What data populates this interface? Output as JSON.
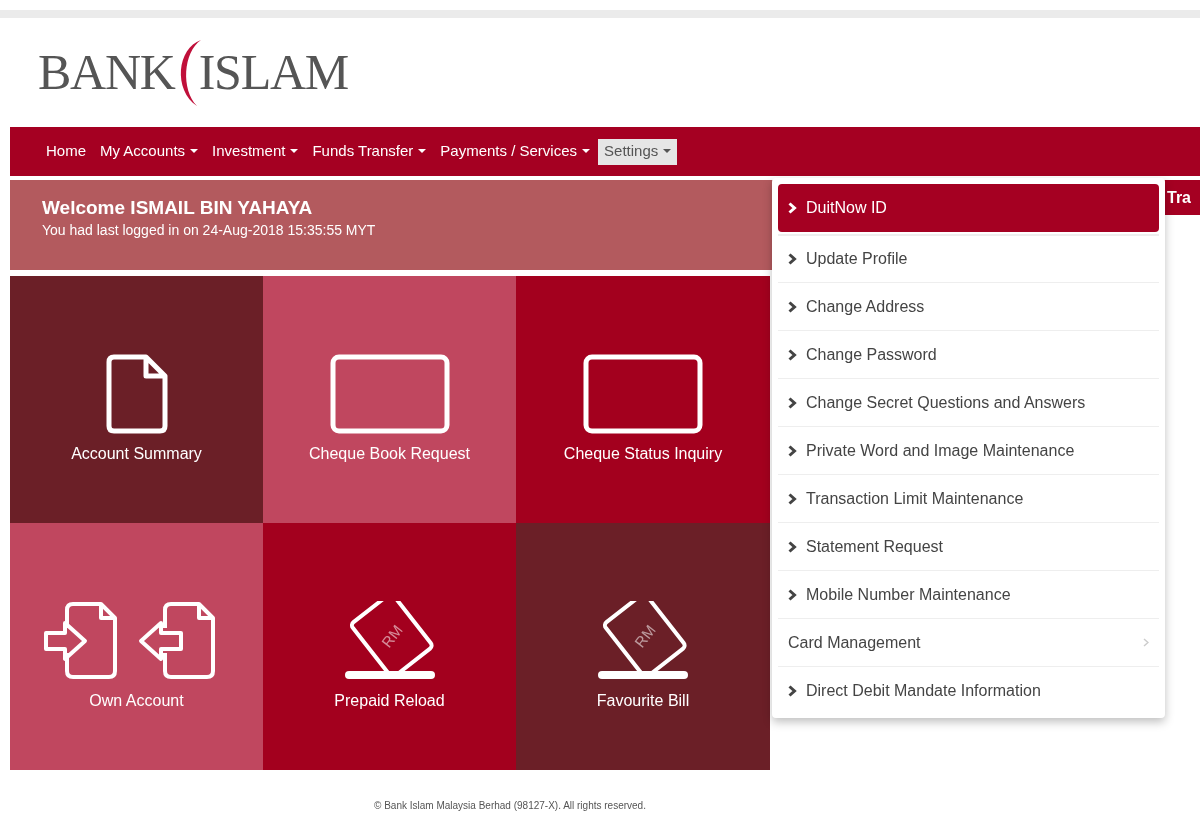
{
  "logo": {
    "left": "BANK",
    "right": "ISLAM"
  },
  "nav": [
    {
      "label": "Home",
      "dropdown": false,
      "selected": false
    },
    {
      "label": "My Accounts",
      "dropdown": true,
      "selected": false
    },
    {
      "label": "Investment",
      "dropdown": true,
      "selected": false
    },
    {
      "label": "Funds Transfer",
      "dropdown": true,
      "selected": false
    },
    {
      "label": "Payments / Services",
      "dropdown": true,
      "selected": false
    },
    {
      "label": "Settings",
      "dropdown": true,
      "selected": true
    }
  ],
  "welcome": {
    "title": "Welcome ISMAIL BIN YAHAYA",
    "subtitle": "You had last logged in on 24-Aug-2018 15:35:55 MYT"
  },
  "side_tab": "Tra",
  "tiles": [
    {
      "label": "Account Summary",
      "color": "#6b1f27",
      "kind": "document"
    },
    {
      "label": "Cheque Book Request",
      "color": "#c0475f",
      "kind": "cheque"
    },
    {
      "label": "Cheque Status Inquiry",
      "color": "#a3001e",
      "kind": "cheque"
    },
    {
      "label": "Own Account",
      "color": "#c0475f",
      "kind": "transfer"
    },
    {
      "label": "Prepaid Reload",
      "color": "#a3001e",
      "kind": "card",
      "icon_text": "RM"
    },
    {
      "label": "Favourite Bill",
      "color": "#6b1f27",
      "kind": "card",
      "icon_text": "RM"
    }
  ],
  "settings_menu": [
    {
      "label": "DuitNow ID",
      "kind": "link",
      "selected": true
    },
    {
      "label": "Update Profile",
      "kind": "link",
      "selected": false
    },
    {
      "label": "Change Address",
      "kind": "link",
      "selected": false
    },
    {
      "label": "Change Password",
      "kind": "link",
      "selected": false
    },
    {
      "label": "Change Secret Questions and Answers",
      "kind": "link",
      "selected": false
    },
    {
      "label": "Private Word and Image Maintenance",
      "kind": "link",
      "selected": false
    },
    {
      "label": "Transaction Limit Maintenance",
      "kind": "link",
      "selected": false
    },
    {
      "label": "Statement Request",
      "kind": "link",
      "selected": false
    },
    {
      "label": "Mobile Number Maintenance",
      "kind": "link",
      "selected": false
    },
    {
      "label": "Card Management",
      "kind": "submenu",
      "selected": false
    },
    {
      "label": "Direct Debit Mandate Information",
      "kind": "link",
      "selected": false
    }
  ],
  "footer": "© Bank Islam Malaysia Berhad (98127-X). All rights reserved."
}
